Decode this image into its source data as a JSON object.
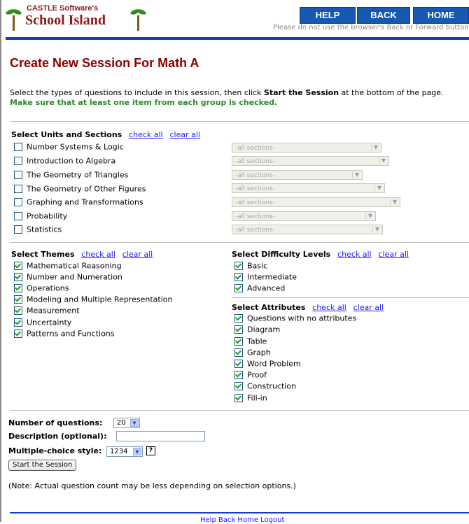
{
  "header": {
    "logo_small": "CASTLE Software's",
    "logo_big": "School Island",
    "nav": [
      {
        "label": "HELP"
      },
      {
        "label": "BACK"
      },
      {
        "label": "HOME"
      }
    ],
    "note": "Please do not use the browser's Back or Forward buttons"
  },
  "title": "Create New Session For Math A",
  "intro": {
    "text1": "Select the types of questions to include in this session, then click ",
    "bold": "Start the Session",
    "text2": " at the bottom of the page.",
    "warning": "Make sure that at least one item from each group is checked."
  },
  "units": {
    "heading": "Select Units and Sections",
    "check_all": "check all",
    "clear_all": "clear all",
    "select_placeholder": "-all sections-",
    "items": [
      {
        "label": "Number Systems & Logic",
        "checked": false
      },
      {
        "label": "Introduction to Algebra",
        "checked": false
      },
      {
        "label": "The Geometry of Triangles",
        "checked": false
      },
      {
        "label": "The Geometry of Other Figures",
        "checked": false
      },
      {
        "label": "Graphing and Transformations",
        "checked": false
      },
      {
        "label": "Probability",
        "checked": false
      },
      {
        "label": "Statistics",
        "checked": false
      }
    ]
  },
  "themes": {
    "heading": "Select Themes",
    "check_all": "check all",
    "clear_all": "clear all",
    "items": [
      {
        "label": "Mathematical Reasoning",
        "checked": true
      },
      {
        "label": "Number and Numeration",
        "checked": true
      },
      {
        "label": "Operations",
        "checked": true
      },
      {
        "label": "Modeling and Multiple Representation",
        "checked": true
      },
      {
        "label": "Measurement",
        "checked": true
      },
      {
        "label": "Uncertainty",
        "checked": true
      },
      {
        "label": "Patterns and Functions",
        "checked": true
      }
    ]
  },
  "difficulty": {
    "heading": "Select Difficulty Levels",
    "check_all": "check all",
    "clear_all": "clear all",
    "items": [
      {
        "label": "Basic",
        "checked": true
      },
      {
        "label": "Intermediate",
        "checked": true
      },
      {
        "label": "Advanced",
        "checked": true
      }
    ]
  },
  "attributes": {
    "heading": "Select Attributes",
    "check_all": "check all",
    "clear_all": "clear all",
    "items": [
      {
        "label": "Questions with no attributes",
        "checked": true
      },
      {
        "label": "Diagram",
        "checked": true
      },
      {
        "label": "Table",
        "checked": true
      },
      {
        "label": "Graph",
        "checked": true
      },
      {
        "label": "Word Problem",
        "checked": true
      },
      {
        "label": "Proof",
        "checked": true
      },
      {
        "label": "Construction",
        "checked": true
      },
      {
        "label": "Fill-in",
        "checked": true
      }
    ]
  },
  "form": {
    "num_questions_label": "Number of questions:",
    "num_questions_value": "20",
    "description_label": "Description (optional):",
    "description_value": "",
    "mc_style_label": "Multiple-choice style:",
    "mc_style_value": "1234",
    "help_icon": "?",
    "start_button": "Start the Session",
    "note": "(Note: Actual question count may be less depending on selection options.)"
  },
  "footer": {
    "links": "Help Back Home Logout"
  }
}
